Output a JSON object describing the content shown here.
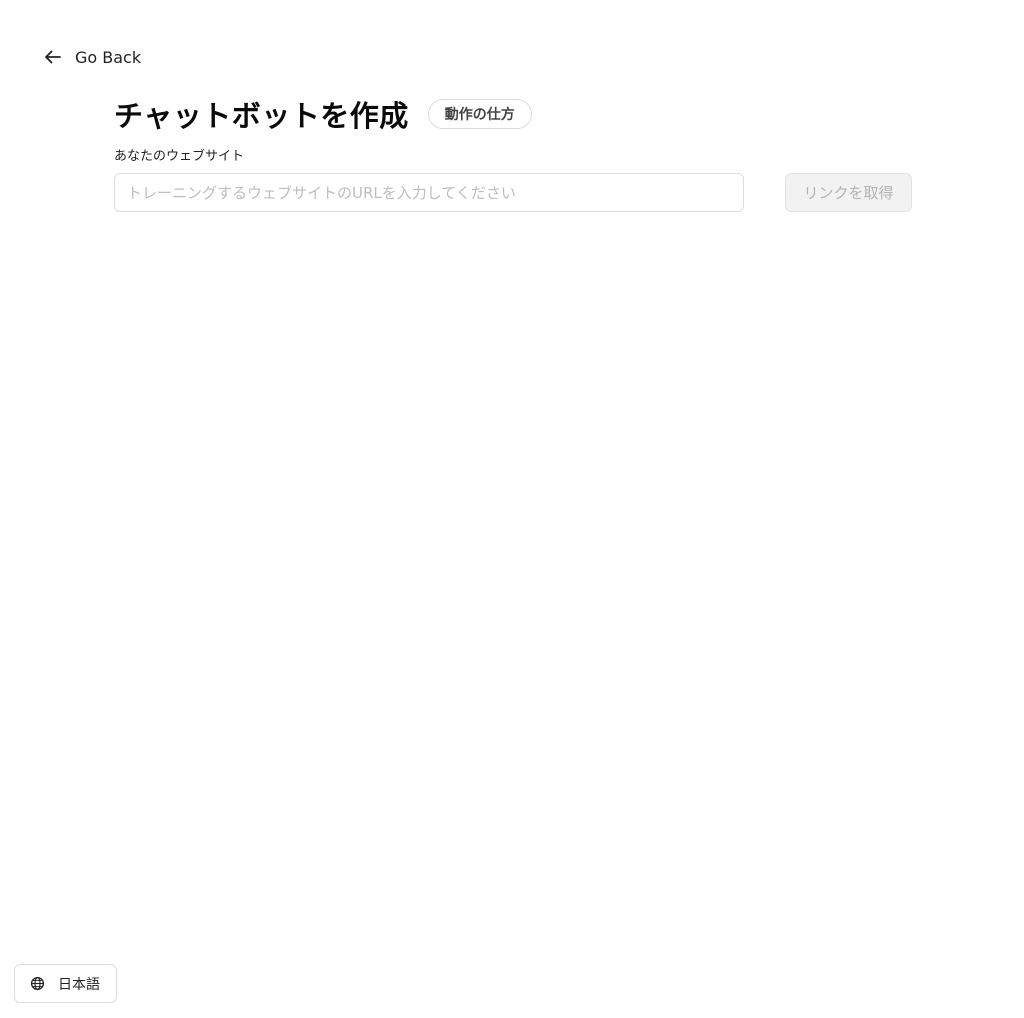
{
  "nav": {
    "back_label": "Go Back",
    "back_icon": "arrow-left-icon"
  },
  "header": {
    "title": "チャットボットを作成",
    "how_it_works_label": "動作の仕方"
  },
  "form": {
    "website_label": "あなたのウェブサイト",
    "url_input": {
      "value": "",
      "placeholder": "トレーニングするウェブサイトのURLを入力してください"
    },
    "fetch_button_label": "リンクを取得"
  },
  "footer": {
    "language_label": "日本語",
    "language_icon": "globe-icon"
  }
}
